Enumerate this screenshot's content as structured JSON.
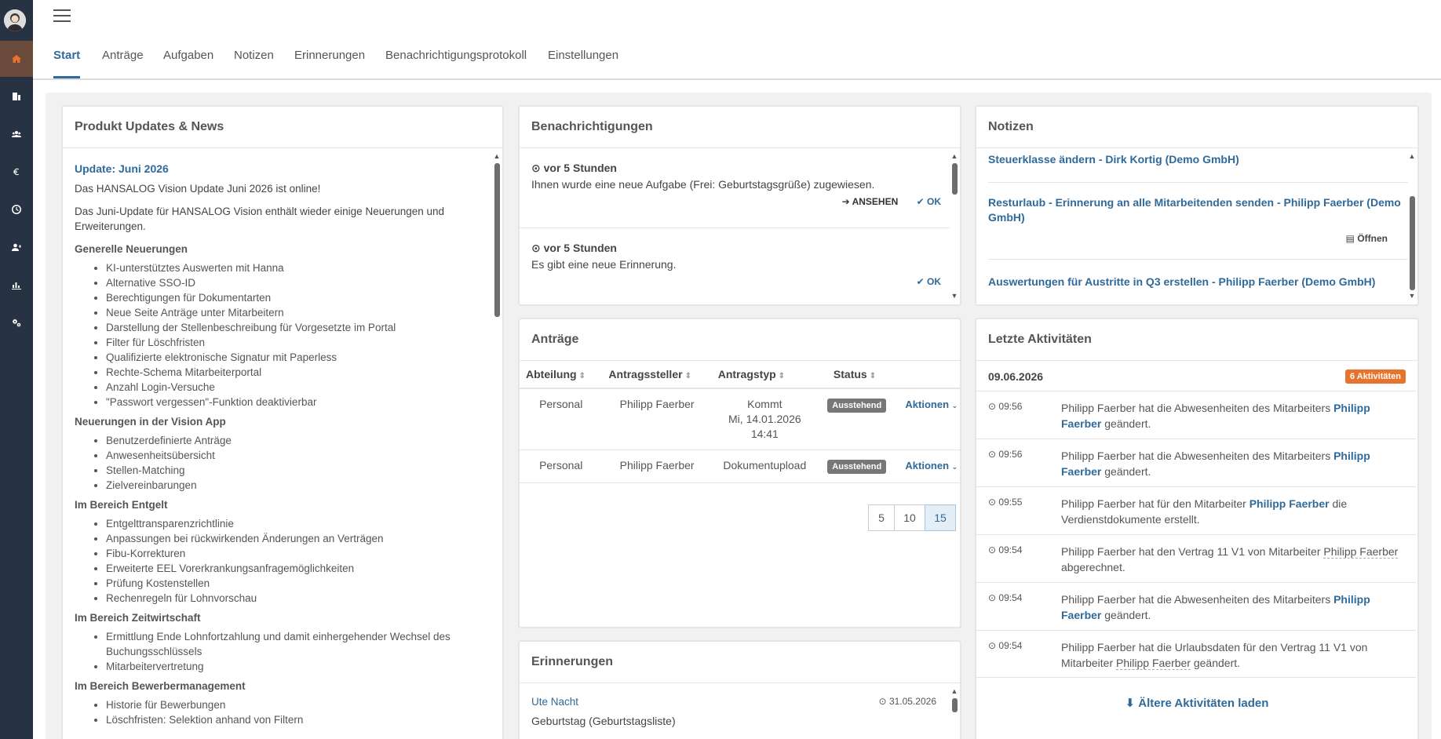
{
  "nav": {
    "tabs": [
      "Start",
      "Anträge",
      "Aufgaben",
      "Notizen",
      "Erinnerungen",
      "Benachrichtigungsprotokoll",
      "Einstellungen"
    ]
  },
  "news": {
    "title": "Produkt Updates & News",
    "update_title": "Update: Juni 2026",
    "intro1": "Das HANSALOG Vision Update Juni 2026 ist online!",
    "intro2": "Das Juni-Update für HANSALOG Vision enthält wieder einige Neuerungen und Erweiterungen.",
    "sections": [
      {
        "heading": "Generelle Neuerungen",
        "items": [
          "KI-unterstütztes Auswerten mit Hanna",
          "Alternative SSO-ID",
          "Berechtigungen für Dokumentarten",
          "Neue Seite Anträge unter Mitarbeitern",
          "Darstellung der Stellenbeschreibung für Vorgesetzte im Portal",
          "Filter für Löschfristen",
          "Qualifizierte elektronische Signatur mit Paperless",
          "Rechte-Schema Mitarbeiterportal",
          "Anzahl Login-Versuche",
          "\"Passwort vergessen\"-Funktion deaktivierbar"
        ]
      },
      {
        "heading": "Neuerungen in der Vision App",
        "items": [
          "Benutzerdefinierte Anträge",
          "Anwesenheitsübersicht",
          "Stellen-Matching",
          "Zielvereinbarungen"
        ]
      },
      {
        "heading": "Im Bereich Entgelt",
        "items": [
          "Entgelttransparenzrichtlinie",
          "Anpassungen bei rückwirkenden Änderungen an Verträgen",
          "Fibu-Korrekturen",
          "Erweiterte EEL Vorerkrankungsanfragemöglichkeiten",
          "Prüfung Kostenstellen",
          "Rechenregeln für Lohnvorschau"
        ]
      },
      {
        "heading": "Im Bereich Zeitwirtschaft",
        "items": [
          "Ermittlung Ende Lohnfortzahlung und damit einhergehender Wechsel des Buchungsschlüssels",
          "Mitarbeitervertretung"
        ]
      },
      {
        "heading": "Im Bereich Bewerbermanagement",
        "items": [
          "Historie für Bewerbungen",
          "Löschfristen: Selektion anhand von Filtern"
        ]
      }
    ]
  },
  "notifications": {
    "title": "Benachrichtigungen",
    "items": [
      {
        "time": "vor 5 Stunden",
        "message": "Ihnen wurde eine neue Aufgabe (Frei: Geburtstagsgrüße) zugewiesen.",
        "see": "ANSEHEN",
        "ok": "OK"
      },
      {
        "time": "vor 5 Stunden",
        "message": "Es gibt eine neue Erinnerung.",
        "ok": "OK"
      }
    ]
  },
  "requests": {
    "title": "Anträge",
    "columns": [
      "Abteilung",
      "Antragssteller",
      "Antragstyp",
      "Status"
    ],
    "rows": [
      {
        "abteilung": "Personal",
        "antragsteller": "Philipp Faerber",
        "typ_l1": "Kommt",
        "typ_l2": "Mi, 14.01.2026",
        "typ_l3": "14:41",
        "status": "Ausstehend",
        "actions": "Aktionen"
      },
      {
        "abteilung": "Personal",
        "antragsteller": "Philipp Faerber",
        "typ_l1": "Dokumentupload",
        "status": "Ausstehend",
        "actions": "Aktionen"
      }
    ],
    "page_sizes": [
      "5",
      "10",
      "15"
    ],
    "page_size_selected": "15"
  },
  "reminders": {
    "title": "Erinnerungen",
    "items": [
      {
        "name": "Ute Nacht",
        "date": "31.05.2026",
        "text": "Geburtstag (Geburtstagsliste)"
      }
    ]
  },
  "notes": {
    "title": "Notizen",
    "items": [
      {
        "text": "Steuerklasse ändern - Dirk Kortig (Demo GmbH)"
      },
      {
        "text": "Resturlaub - Erinnerung an alle Mitarbeitenden senden - Philipp Faerber (Demo GmbH)",
        "open": "Öffnen"
      },
      {
        "text": "Auswertungen für Austritte in Q3 erstellen - Philipp Faerber (Demo GmbH)"
      }
    ]
  },
  "activities": {
    "title": "Letzte Aktivitäten",
    "date": "09.06.2026",
    "count_badge": "6 Aktivitäten",
    "items": [
      {
        "time": "09:56",
        "pre": "Philipp Faerber hat die Abwesenheiten des Mitarbeiters ",
        "link": "Philipp Faerber",
        "post": " geändert."
      },
      {
        "time": "09:56",
        "pre": "Philipp Faerber hat die Abwesenheiten des Mitarbeiters ",
        "link": "Philipp Faerber",
        "post": " geändert."
      },
      {
        "time": "09:55",
        "pre": "Philipp Faerber hat für den Mitarbeiter ",
        "link": "Philipp Faerber",
        "post": " die Verdienstdokumente erstellt."
      },
      {
        "time": "09:54",
        "pre": "Philipp Faerber hat den Vertrag 11 V1 von Mitarbeiter ",
        "dotted": "Philipp Faerber",
        "post": " abgerechnet."
      },
      {
        "time": "09:54",
        "pre": "Philipp Faerber hat die Abwesenheiten des Mitarbeiters ",
        "link": "Philipp Faerber",
        "post": " geändert."
      },
      {
        "time": "09:54",
        "pre": "Philipp Faerber hat die Urlaubsdaten für den Vertrag 11 V1 von Mitarbeiter ",
        "dotted": "Philipp Faerber",
        "post": " geändert."
      }
    ],
    "load_more": "Ältere Aktivitäten laden"
  }
}
